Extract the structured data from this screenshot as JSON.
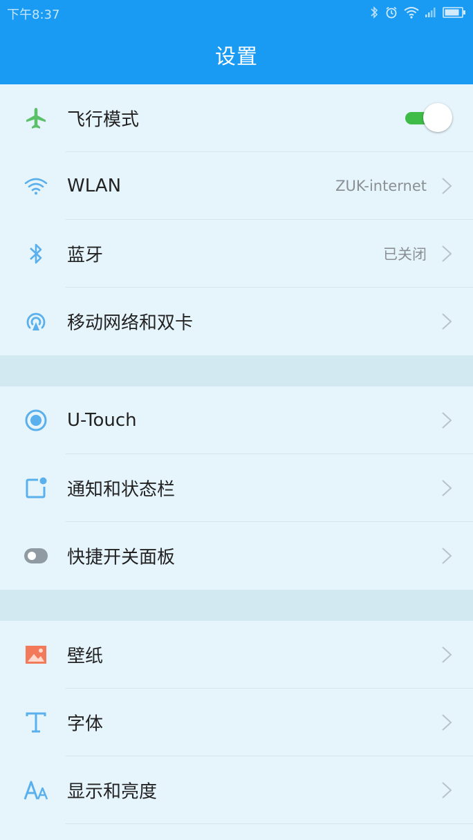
{
  "status_bar": {
    "time": "下午8:37",
    "icons": [
      "bluetooth-icon",
      "alarm-icon",
      "wifi-icon",
      "signal-icon",
      "battery-icon"
    ]
  },
  "title": "设置",
  "colors": {
    "header": "#1a9bf3",
    "background": "#e6f4fc",
    "toggle_on": "#3fbb48",
    "icon_blue": "#5ab0ec",
    "airplane_green": "#5cc06b",
    "wallpaper_orange": "#f27a5a"
  },
  "sections": [
    {
      "items": [
        {
          "label": "飞行模式",
          "icon": "airplane-icon",
          "toggle": true
        },
        {
          "label": "WLAN",
          "icon": "wifi-icon",
          "value": "ZUK-internet"
        },
        {
          "label": "蓝牙",
          "icon": "bluetooth-icon",
          "value": "已关闭"
        },
        {
          "label": "移动网络和双卡",
          "icon": "mobile-network-icon"
        }
      ]
    },
    {
      "items": [
        {
          "label": "U-Touch",
          "icon": "u-touch-icon"
        },
        {
          "label": "通知和状态栏",
          "icon": "notification-icon"
        },
        {
          "label": "快捷开关面板",
          "icon": "quick-switch-icon"
        }
      ]
    },
    {
      "items": [
        {
          "label": "壁纸",
          "icon": "wallpaper-icon"
        },
        {
          "label": "字体",
          "icon": "font-icon"
        },
        {
          "label": "显示和亮度",
          "icon": "display-icon"
        }
      ]
    }
  ]
}
